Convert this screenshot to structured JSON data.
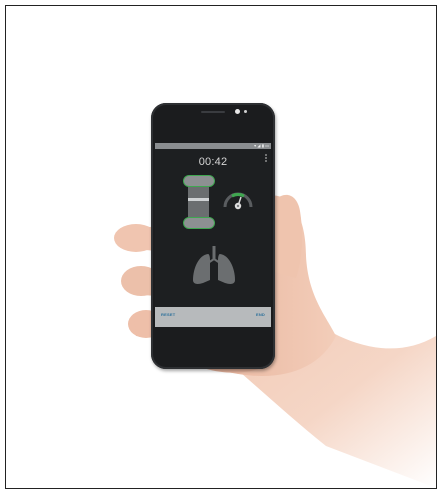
{
  "status_bar": {
    "icons": [
      "wifi-icon",
      "signal-icon",
      "battery-icon"
    ],
    "text": "▾ ◢ ▮ ▭"
  },
  "timer": {
    "value": "00:42"
  },
  "controls": {
    "reset_label": "RESET",
    "end_label": "END"
  },
  "colors": {
    "accent": "#3fa750",
    "screen_bg": "#1d1f21",
    "bar": "#b7babc",
    "button_text": "#2a6f9a"
  }
}
